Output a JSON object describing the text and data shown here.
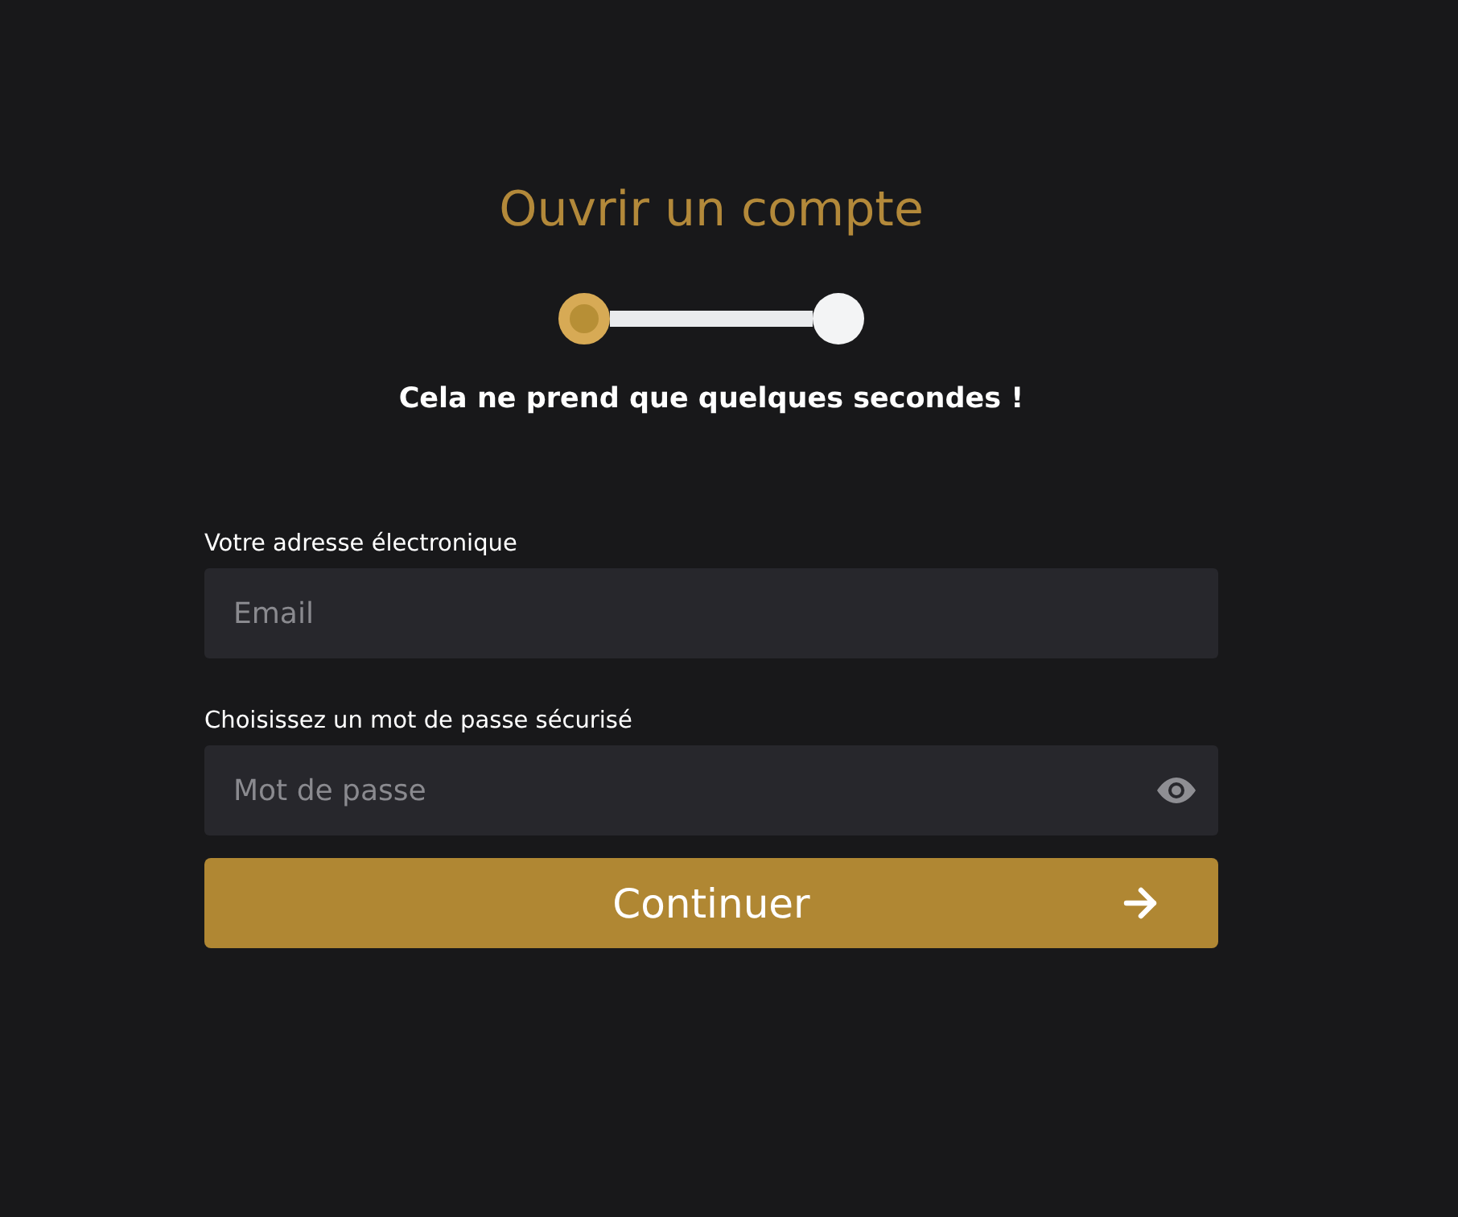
{
  "title": "Ouvrir un compte",
  "steps": [
    {
      "selected": true
    },
    {
      "selected": false
    }
  ],
  "subtitle": "Cela ne prend que quelques secondes !",
  "fields": [
    {
      "label": "Votre adresse électronique",
      "placeholder": "Email",
      "kind": "email"
    },
    {
      "label": "Choisissez un mot de passe sécurisé",
      "placeholder": "Mot de passe",
      "kind": "password"
    }
  ],
  "button": {
    "label": "Continuer"
  }
}
